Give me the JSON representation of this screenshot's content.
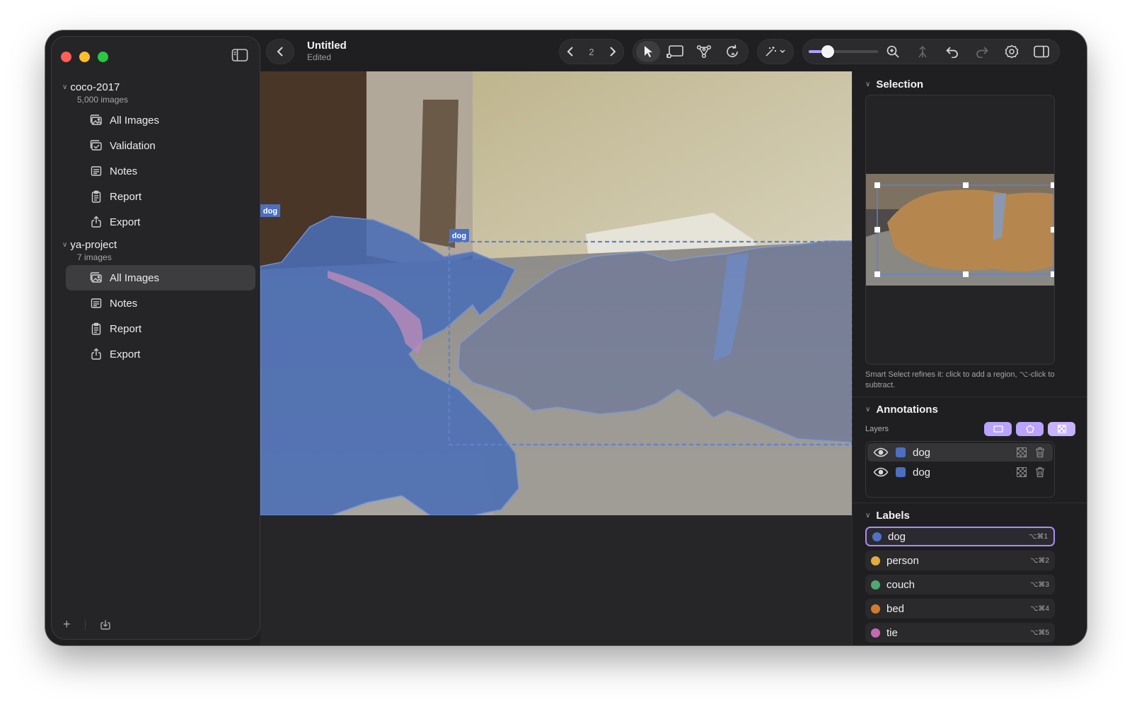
{
  "window": {
    "doc_title": "Untitled",
    "doc_status": "Edited",
    "page_number": "2",
    "zoom_slider_fraction": 0.28
  },
  "sidebar": {
    "groups": [
      {
        "title": "coco-2017",
        "subtitle": "5,000 images",
        "items": [
          {
            "label": "All Images",
            "icon": "photos-icon"
          },
          {
            "label": "Validation",
            "icon": "photos-check-icon"
          },
          {
            "label": "Notes",
            "icon": "notes-icon"
          },
          {
            "label": "Report",
            "icon": "report-icon"
          },
          {
            "label": "Export",
            "icon": "export-icon"
          }
        ]
      },
      {
        "title": "ya-project",
        "subtitle": "7 images",
        "items": [
          {
            "label": "All Images",
            "icon": "photos-icon"
          },
          {
            "label": "Notes",
            "icon": "notes-icon"
          },
          {
            "label": "Report",
            "icon": "report-icon"
          },
          {
            "label": "Export",
            "icon": "export-icon"
          }
        ]
      }
    ],
    "footer": {
      "add": "+",
      "import_icon": "import-icon"
    }
  },
  "canvas": {
    "annotation_tags": [
      "dog",
      "dog"
    ],
    "mask_color": "#4a6db5"
  },
  "panel": {
    "selection_title": "Selection",
    "hint": "Smart Select refines it: click to add a region, ⌥-click to subtract.",
    "annotations_title": "Annotations",
    "layers_label": "Layers",
    "layers": [
      {
        "name": "dog",
        "color": "#4d6fc0"
      },
      {
        "name": "dog",
        "color": "#4d6fc0"
      }
    ],
    "labels_title": "Labels",
    "labels": [
      {
        "name": "dog",
        "color": "#4f72c9",
        "shortcut": "⌥⌘1"
      },
      {
        "name": "person",
        "color": "#e2ad3c",
        "shortcut": "⌥⌘2"
      },
      {
        "name": "couch",
        "color": "#4fa872",
        "shortcut": "⌥⌘3"
      },
      {
        "name": "bed",
        "color": "#d47a2c",
        "shortcut": "⌥⌘4"
      },
      {
        "name": "tie",
        "color": "#c46bb0",
        "shortcut": "⌥⌘5"
      }
    ]
  }
}
